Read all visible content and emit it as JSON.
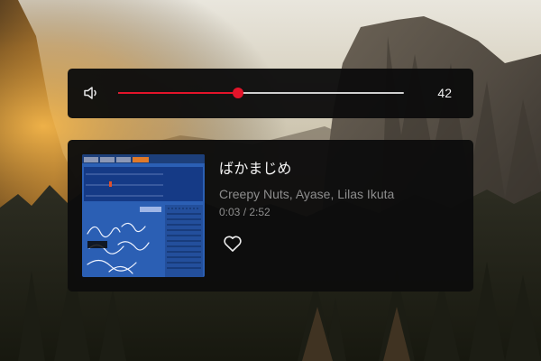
{
  "volume": {
    "icon": "speaker-low-icon",
    "level": 42,
    "value_text": "42",
    "accent_color": "#e3142a"
  },
  "track": {
    "title": "ばかまじめ",
    "artists": "Creepy Nuts, Ayase, Lilas Ikuta",
    "time": "0:03 / 2:52",
    "like_icon": "heart-outline-icon",
    "cover_icon": "album-cover-cassette-player-image"
  }
}
